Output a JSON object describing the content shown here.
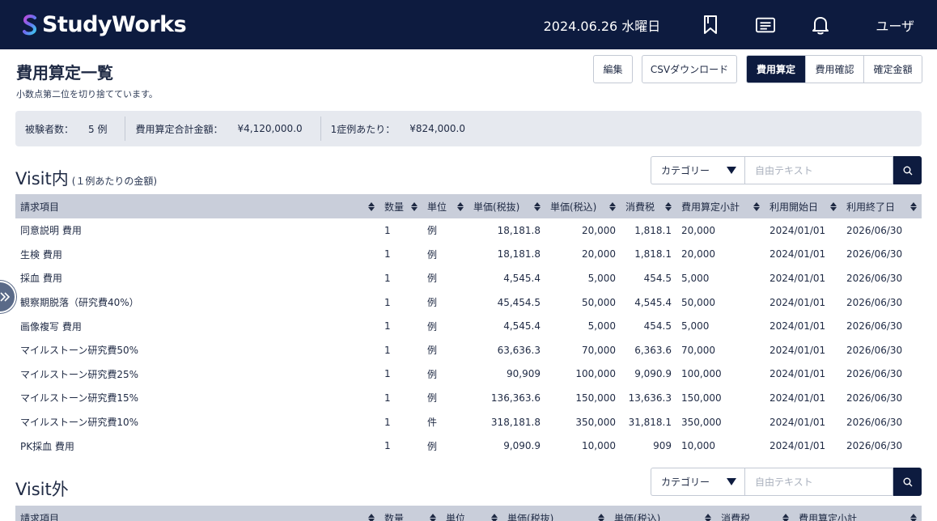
{
  "header": {
    "logo_text": "StudyWorks",
    "date": "2024.06.26 水曜日",
    "icons": [
      "bookmark-icon",
      "message-icon",
      "bell-icon"
    ],
    "user": "ユーザ"
  },
  "page": {
    "title": "費用算定一覧",
    "note": "小数点第二位を切り捨てています。",
    "edit_label": "編集",
    "csv_label": "CSVダウンロード",
    "segments": [
      {
        "label": "費用算定",
        "active": true
      },
      {
        "label": "費用確認",
        "active": false
      },
      {
        "label": "確定金額",
        "active": false
      }
    ]
  },
  "summary": {
    "subjects_label": "被験者数：",
    "subjects_value": "5 例",
    "total_label": "費用算定合計金額：",
    "total_value": "¥4,120,000.0",
    "per_case_label": "1症例あたり：",
    "per_case_value": "¥824,000.0"
  },
  "filter": {
    "category_label": "カテゴリー",
    "text_placeholder": "自由テキスト"
  },
  "visit_in": {
    "title": "Visit内",
    "subtitle": "(１例あたりの金額)",
    "columns": [
      "請求項目",
      "数量",
      "単位",
      "単価(税抜)",
      "単価(税込)",
      "消費税",
      "費用算定小計",
      "利用開始日",
      "利用終了日"
    ],
    "rows": [
      [
        "同意説明 費用",
        "1",
        "例",
        "18,181.8",
        "20,000",
        "1,818.1",
        "20,000",
        "2024/01/01",
        "2026/06/30"
      ],
      [
        "生検 費用",
        "1",
        "例",
        "18,181.8",
        "20,000",
        "1,818.1",
        "20,000",
        "2024/01/01",
        "2026/06/30"
      ],
      [
        "採血 費用",
        "1",
        "例",
        "4,545.4",
        "5,000",
        "454.5",
        "5,000",
        "2024/01/01",
        "2026/06/30"
      ],
      [
        "観察期脱落（研究費40%）",
        "1",
        "例",
        "45,454.5",
        "50,000",
        "4,545.4",
        "50,000",
        "2024/01/01",
        "2026/06/30"
      ],
      [
        "画像複写 費用",
        "1",
        "例",
        "4,545.4",
        "5,000",
        "454.5",
        "5,000",
        "2024/01/01",
        "2026/06/30"
      ],
      [
        "マイルストーン研究費50%",
        "1",
        "例",
        "63,636.3",
        "70,000",
        "6,363.6",
        "70,000",
        "2024/01/01",
        "2026/06/30"
      ],
      [
        "マイルストーン研究費25%",
        "1",
        "例",
        "90,909",
        "100,000",
        "9,090.9",
        "100,000",
        "2024/01/01",
        "2026/06/30"
      ],
      [
        "マイルストーン研究費15%",
        "1",
        "例",
        "136,363.6",
        "150,000",
        "13,636.3",
        "150,000",
        "2024/01/01",
        "2026/06/30"
      ],
      [
        "マイルストーン研究費10%",
        "1",
        "件",
        "318,181.8",
        "350,000",
        "31,818.1",
        "350,000",
        "2024/01/01",
        "2026/06/30"
      ],
      [
        "PK採血 費用",
        "1",
        "例",
        "9,090.9",
        "10,000",
        "909",
        "10,000",
        "2024/01/01",
        "2026/06/30"
      ]
    ]
  },
  "visit_out": {
    "title": "Visit外",
    "columns": [
      "請求項目",
      "数量",
      "単位",
      "単価(税抜)",
      "単価(税込)",
      "消費税",
      "費用算定小計"
    ]
  }
}
